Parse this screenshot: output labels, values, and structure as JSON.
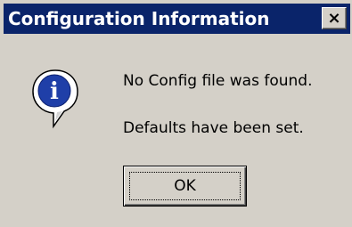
{
  "window": {
    "title": "Configuration Information",
    "close_label": "×"
  },
  "icon": {
    "name": "information-icon",
    "glyph": "i",
    "color": "#1f3fa8"
  },
  "message": {
    "line1": "No Config file was found.",
    "line2": "Defaults have been set."
  },
  "buttons": {
    "ok_label": "OK"
  }
}
